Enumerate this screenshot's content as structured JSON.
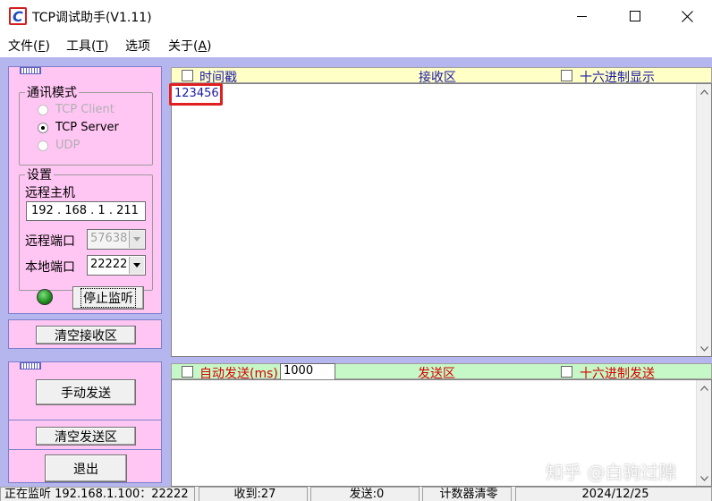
{
  "window": {
    "title": "TCP调试助手(V1.11)"
  },
  "menu": {
    "items": [
      {
        "label": "文件(",
        "key": "F",
        "suffix": ")"
      },
      {
        "label": "工具(",
        "key": "T",
        "suffix": ")"
      },
      {
        "label": "选项",
        "key": "",
        "suffix": ""
      },
      {
        "label": "关于(",
        "key": "A",
        "suffix": ")"
      }
    ]
  },
  "comm_mode": {
    "legend": "通讯模式",
    "options": [
      {
        "label": "TCP Client",
        "selected": false,
        "enabled": false
      },
      {
        "label": "TCP Server",
        "selected": true,
        "enabled": true
      },
      {
        "label": "UDP",
        "selected": false,
        "enabled": false
      }
    ]
  },
  "settings": {
    "legend": "设置",
    "remote_host_label": "远程主机",
    "remote_host_value": "192 . 168 .  1  . 211",
    "remote_port_label": "远程端口",
    "remote_port_value": "57638",
    "local_port_label": "本地端口",
    "local_port_value": "22222",
    "stop_listen_button": "停止监听"
  },
  "left_buttons": {
    "clear_receive": "清空接收区",
    "manual_send": "手动发送",
    "clear_send": "清空发送区",
    "exit": "退出"
  },
  "receive": {
    "timestamp_label": "时间戳",
    "area_label": "接收区",
    "hex_display_label": "十六进制显示",
    "content": "123456"
  },
  "send": {
    "auto_send_label": "自动发送(ms)",
    "interval_value": "1000",
    "area_label": "发送区",
    "hex_send_label": "十六进制发送",
    "content": ""
  },
  "status": {
    "listening": "正在监听 192.168.1.100：22222",
    "received": "收到:27",
    "sent": "发送:0",
    "reset_counter": "计数器清零",
    "date": "2024/12/25"
  },
  "watermark": "知乎 @白驹过隙",
  "colors": {
    "panel_bg": "#b6b6ee",
    "left_box_bg": "#ffc6f3",
    "receive_header_bg": "#ffffc6",
    "send_header_bg": "#c6f7c6",
    "header_text_blue": "#1a1aa8",
    "header_text_red": "#d80000",
    "highlight_red": "#e02020"
  }
}
